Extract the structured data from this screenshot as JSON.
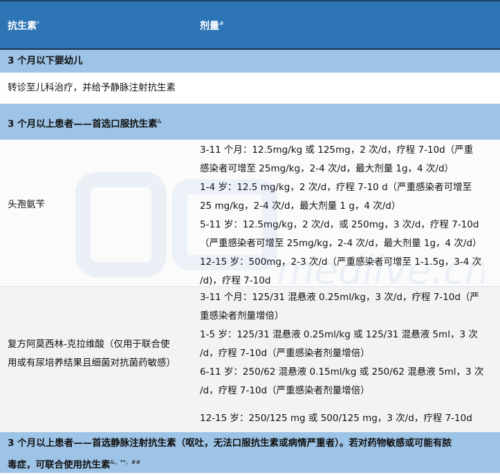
{
  "header": {
    "col1": "抗生素",
    "col1_sup": "*",
    "col2": "剂量",
    "col2_sup": "#"
  },
  "section1": {
    "title": "3 个月以下婴幼儿",
    "note": "转诊至儿科治疗，并给予静脉注射抗生素"
  },
  "section2": {
    "title": "3 个月以上患者——首选口服抗生素",
    "title_sup": "&"
  },
  "drugs": [
    {
      "name_lines": [
        "头孢氨苄"
      ],
      "dose_lines": [
        "3-11 个月：12.5mg/kg 或 125mg，2 次/d，疗程 7-10d（严重",
        "感染者可增至 25mg/kg，2-4 次/d，最大剂量 1g，4 次/d）",
        "1-4  岁：12.5 mg/kg，2 次/d，疗程 7-10 d（严重感染者可增至",
        "25 mg/kg，2-4 次/d，最大剂量 1 g，4 次/d）",
        "5-11 岁：12.5mg/kg，2 次/d，或  250mg，3 次/d，疗程 7-10d",
        "（严重感染者可增至 25mg/kg，2-4 次/d，最大剂量 1g，4 次/d）",
        "12-15 岁：500mg，2-3 次/d（严重感染者可增至 1-1.5g，3-4 次",
        "/d)，疗程 7-10d"
      ]
    },
    {
      "name_lines": [
        "复方阿莫西林-克拉维酸（仅用于联合使",
        "用或有尿培养结果且细菌对抗菌药敏感）"
      ],
      "dose_lines": [
        "3-11 个月：125/31 混悬液 0.25ml/kg，3 次/d，疗程 7-10d（严",
        "重感染者剂量增倍）",
        "1-5  岁：125/31 混悬液 0.25ml/kg 或  125/31 混悬液 5ml，3 次",
        "/d，疗程 7-10d（严重感染者剂量增倍）",
        "6-11 岁：250/62 混悬液 0.15ml/kg  或 250/62 混悬液 5ml，3 次",
        "/d，疗程 7-10d（严重感染者剂量增倍）",
        "12-15 岁：250/125 mg 或 500/125 mg，3 次/d，疗程 7-10d"
      ]
    }
  ],
  "section3": {
    "line1": "3 个月以上患者——首选静脉注射抗生素（呕吐，无法口服抗生素或病情严重者）。若对药物敏感或可能有脓",
    "line2": "毒症，可联合使用抗生素",
    "line2_sup": "&，**，##"
  },
  "watermark": "medlive.cn"
}
